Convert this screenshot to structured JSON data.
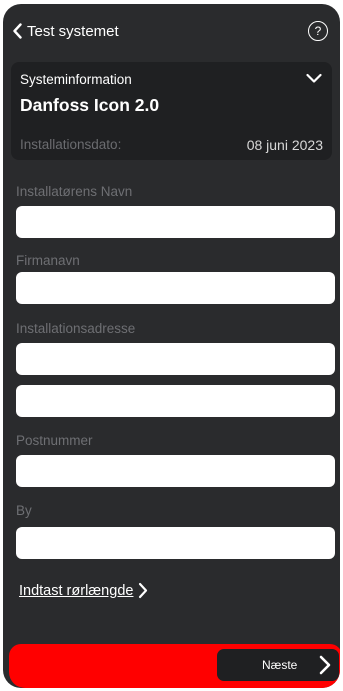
{
  "header": {
    "back_label": "Test systemet",
    "help_icon_text": "?"
  },
  "system_info": {
    "section_label": "Systeminformation",
    "model": "Danfoss Icon 2.0",
    "install_date_label": "Installationsdato:",
    "install_date_value": "08 juni 2023"
  },
  "form": {
    "installer_name_label": "Installatørens Navn",
    "installer_name_value": "",
    "company_label": "Firmanavn",
    "company_value": "",
    "address_label": "Installationsadresse",
    "address_line1_value": "",
    "address_line2_value": "",
    "postcode_label": "Postnummer",
    "postcode_value": "",
    "city_label": "By",
    "city_value": ""
  },
  "pipe_length_link": "Indtast rørlængde",
  "footer": {
    "next_label": "Næste"
  },
  "colors": {
    "background": "#2a2b2d",
    "card": "#1f2022",
    "accent_bar": "#ff0000",
    "muted_text": "#6e6f73"
  }
}
